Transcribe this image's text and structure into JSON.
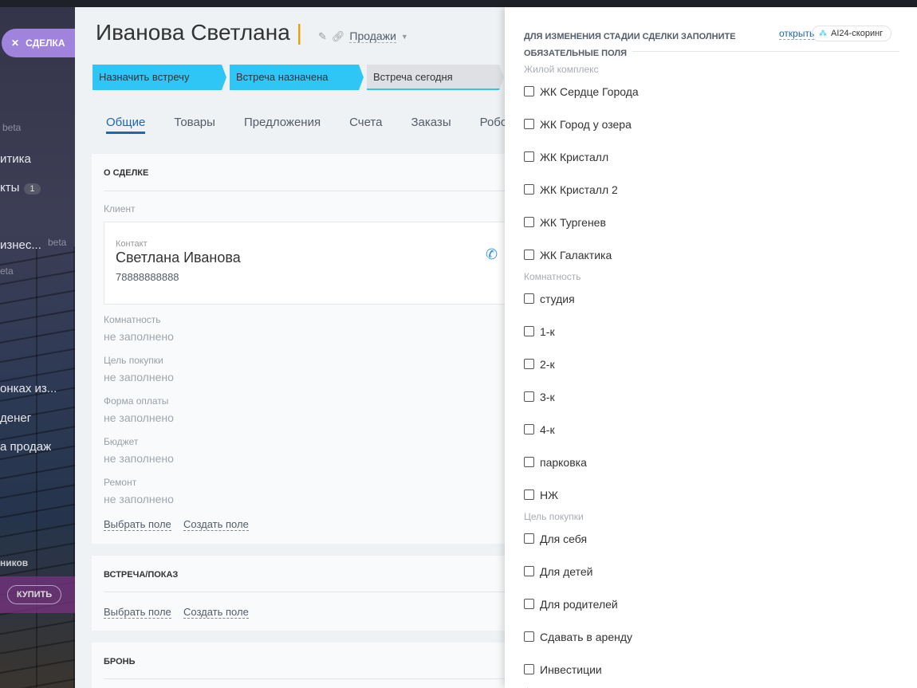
{
  "sidebar": {
    "deal_button": "СДЕЛКА",
    "beta1": "beta",
    "items": [
      "итика",
      "кты",
      "изнес...",
      "онках из...",
      "денег",
      "а продаж",
      "ников"
    ],
    "badge": "1",
    "beta2": "beta",
    "beta3": "eta",
    "buy": "КУПИТЬ"
  },
  "header": {
    "title": "Иванова Светлана",
    "separator": "|",
    "pipeline": "Продажи"
  },
  "stages": [
    "Назначить встречу",
    "Встреча назначена",
    "Встреча сегодня"
  ],
  "tabs": [
    "Общие",
    "Товары",
    "Предложения",
    "Счета",
    "Заказы",
    "Робот"
  ],
  "deal": {
    "title": "О СДЕЛКЕ",
    "client_label": "Клиент",
    "contact_label": "Контакт",
    "contact_name": "Светлана Иванова",
    "contact_phone": "78888888888",
    "fields": [
      {
        "label": "Комнатность",
        "value": "не заполнено"
      },
      {
        "label": "Цель покупки",
        "value": "не заполнено"
      },
      {
        "label": "Форма оплаты",
        "value": "не заполнено"
      },
      {
        "label": "Бюджет",
        "value": "не заполнено"
      },
      {
        "label": "Ремонт",
        "value": "не заполнено"
      }
    ],
    "select_field": "Выбрать поле",
    "create_field": "Создать поле"
  },
  "meeting": {
    "title": "ВСТРЕЧА/ПОКАЗ",
    "select_field": "Выбрать поле",
    "create_field": "Создать поле"
  },
  "booking": {
    "title": "БРОНЬ"
  },
  "panel": {
    "heading": "ДЛЯ ИЗМЕНЕНИЯ СТАДИИ СДЕЛКИ ЗАПОЛНИТЕ ОБЯЗАТЕЛЬНЫЕ ПОЛЯ",
    "open": "открыть",
    "ai": "AI24-скоринг",
    "accent": "#2fc6f6",
    "groups": [
      {
        "label": "Жилой комплекс",
        "options": [
          "ЖК Сердце Города",
          "ЖК Город у озера",
          "ЖК Кристалл",
          "ЖК Кристалл 2",
          "ЖК Тургенев",
          "ЖК Галактика"
        ]
      },
      {
        "label": "Комнатность",
        "options": [
          "студия",
          "1-к",
          "2-к",
          "3-к",
          "4-к",
          "парковка",
          "НЖ"
        ]
      },
      {
        "label": "Цель покупки",
        "options": [
          "Для себя",
          "Для детей",
          "Для родителей",
          "Сдавать в аренду",
          "Инвестиции"
        ]
      },
      {
        "label": "Форма оплаты",
        "options": []
      }
    ]
  }
}
